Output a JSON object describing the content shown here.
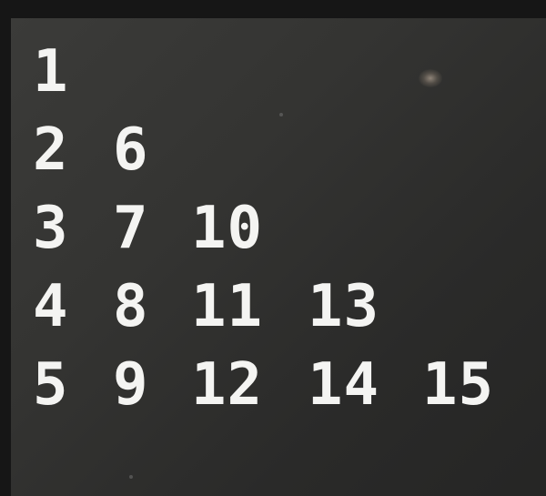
{
  "terminal": {
    "output_rows": [
      [
        "1"
      ],
      [
        "2",
        "6"
      ],
      [
        "3",
        "7",
        "10"
      ],
      [
        "4",
        "8",
        "11",
        "13"
      ],
      [
        "5",
        "9",
        "12",
        "14",
        "15"
      ]
    ]
  }
}
